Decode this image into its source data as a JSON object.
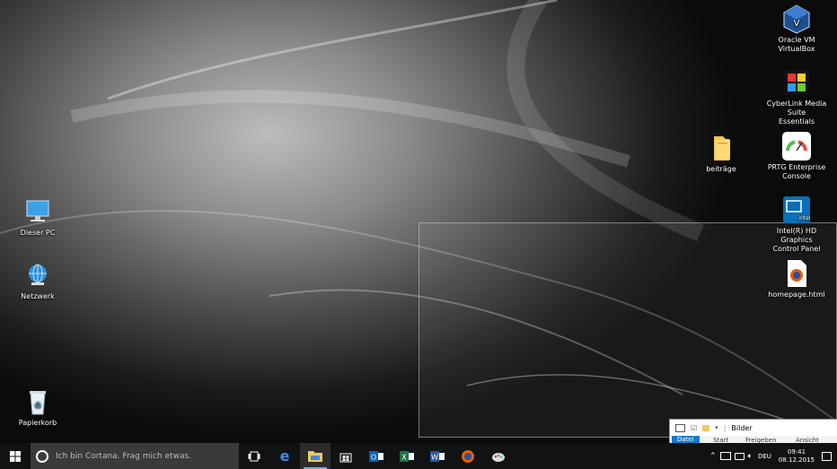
{
  "desktop_icons": {
    "virtualbox": "Oracle VM VirtualBox",
    "cyberlink_l1": "CyberLink Media Suite",
    "cyberlink_l2": "Essentials",
    "beitraege": "beiträge",
    "prtg_l1": "PRTG Enterprise",
    "prtg_l2": "Console",
    "intel_l1": "Intel(R) HD Graphics",
    "intel_l2": "Control Panel",
    "dieser_pc": "Dieser PC",
    "homepage": "homepage.html",
    "netzwerk": "Netzwerk",
    "papierkorb": "Papierkorb"
  },
  "explorer_preview": {
    "title": "Bilder",
    "tabs": [
      "Datei",
      "Start",
      "Freigeben",
      "Ansicht"
    ]
  },
  "taskbar": {
    "search_placeholder": "Ich bin Cortana. Frag mich etwas.",
    "language": "DEU",
    "time": "09:41",
    "date": "08.12.2015",
    "icons": [
      "windows-start-icon",
      "task-view-icon",
      "edge-icon",
      "file-explorer-icon",
      "store-icon",
      "outlook-icon",
      "excel-icon",
      "word-icon",
      "firefox-icon",
      "paint-icon"
    ]
  },
  "colors": {
    "taskbar": "#111214",
    "search_box": "#3a3a3c",
    "accent": "#1979ca"
  }
}
